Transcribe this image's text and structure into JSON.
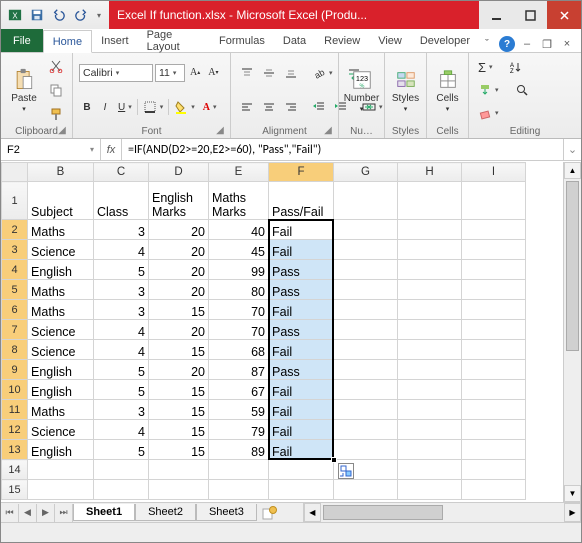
{
  "title": "Excel If function.xlsx - Microsoft Excel (Produ...",
  "tabs": {
    "file": "File",
    "home": "Home",
    "insert": "Insert",
    "pagelayout": "Page Layout",
    "formulas": "Formulas",
    "data": "Data",
    "review": "Review",
    "view": "View",
    "developer": "Developer"
  },
  "ribbon": {
    "clipboard": {
      "label": "Clipboard",
      "paste": "Paste"
    },
    "font": {
      "label": "Font",
      "name": "Calibri",
      "size": "11"
    },
    "alignment": {
      "label": "Alignment"
    },
    "number": {
      "label": "Nu…",
      "btn": "Number"
    },
    "styles": {
      "label": "Styles",
      "btn": "Styles"
    },
    "cells": {
      "label": "Cells",
      "btn": "Cells"
    },
    "editing": {
      "label": "Editing"
    }
  },
  "namebox": "F2",
  "formula": "=IF(AND(D2>=20,E2>=60), \"Pass\",\"Fail\")",
  "columns": [
    "B",
    "C",
    "D",
    "E",
    "F",
    "G",
    "H",
    "I"
  ],
  "headers": {
    "B": "Subject",
    "C": "Class",
    "D": "English Marks",
    "E": "Maths Marks",
    "F": "Pass/Fail"
  },
  "rows": [
    {
      "n": 2,
      "B": "Maths",
      "C": 3,
      "D": 20,
      "E": 40,
      "F": "Fail"
    },
    {
      "n": 3,
      "B": "Science",
      "C": 4,
      "D": 20,
      "E": 45,
      "F": "Fail"
    },
    {
      "n": 4,
      "B": "English",
      "C": 5,
      "D": 20,
      "E": 99,
      "F": "Pass"
    },
    {
      "n": 5,
      "B": "Maths",
      "C": 3,
      "D": 20,
      "E": 80,
      "F": "Pass"
    },
    {
      "n": 6,
      "B": "Maths",
      "C": 3,
      "D": 15,
      "E": 70,
      "F": "Fail"
    },
    {
      "n": 7,
      "B": "Science",
      "C": 4,
      "D": 20,
      "E": 70,
      "F": "Pass"
    },
    {
      "n": 8,
      "B": "Science",
      "C": 4,
      "D": 15,
      "E": 68,
      "F": "Fail"
    },
    {
      "n": 9,
      "B": "English",
      "C": 5,
      "D": 20,
      "E": 87,
      "F": "Pass"
    },
    {
      "n": 10,
      "B": "English",
      "C": 5,
      "D": 15,
      "E": 67,
      "F": "Fail"
    },
    {
      "n": 11,
      "B": "Maths",
      "C": 3,
      "D": 15,
      "E": 59,
      "F": "Fail"
    },
    {
      "n": 12,
      "B": "Science",
      "C": 4,
      "D": 15,
      "E": 79,
      "F": "Fail"
    },
    {
      "n": 13,
      "B": "English",
      "C": 5,
      "D": 15,
      "E": 89,
      "F": "Fail"
    }
  ],
  "sheets": {
    "s1": "Sheet1",
    "s2": "Sheet2",
    "s3": "Sheet3"
  }
}
